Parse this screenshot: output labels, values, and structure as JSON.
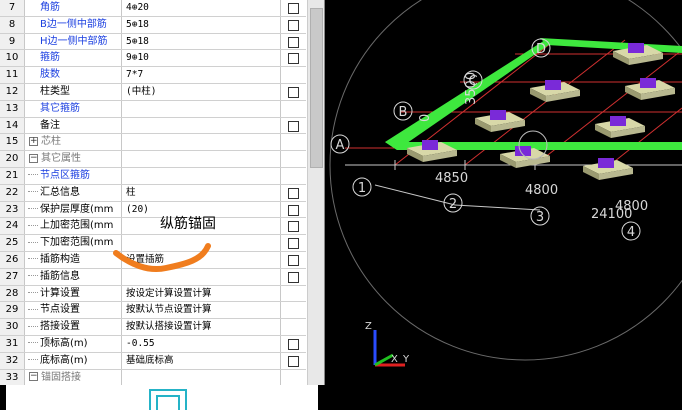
{
  "properties": {
    "rows": [
      {
        "num": "7",
        "name": "角筋",
        "value": "4⊕20",
        "blue": true,
        "checkbox": true
      },
      {
        "num": "8",
        "name": "B边一侧中部筋",
        "value": "5⊕18",
        "blue": true,
        "checkbox": true
      },
      {
        "num": "9",
        "name": "H边一侧中部筋",
        "value": "5⊕18",
        "blue": true,
        "checkbox": true
      },
      {
        "num": "10",
        "name": "箍筋",
        "value": "9⊕10",
        "blue": true,
        "checkbox": true
      },
      {
        "num": "11",
        "name": "肢数",
        "value": "7*7",
        "blue": true,
        "checkbox": false
      },
      {
        "num": "12",
        "name": "柱类型",
        "value": "(中柱)",
        "blue": false,
        "checkbox": true
      },
      {
        "num": "13",
        "name": "其它箍筋",
        "value": "",
        "blue": true,
        "checkbox": false
      },
      {
        "num": "14",
        "name": "备注",
        "value": "",
        "blue": false,
        "checkbox": true
      },
      {
        "num": "15",
        "name": "芯柱",
        "value": "",
        "group": true,
        "toggle": "+",
        "checkbox": false
      },
      {
        "num": "20",
        "name": "其它属性",
        "value": "",
        "group": true,
        "toggle": "−",
        "checkbox": false
      },
      {
        "num": "21",
        "name": "节点区箍筋",
        "value": "",
        "blue": true,
        "child": true,
        "checkbox": false
      },
      {
        "num": "22",
        "name": "汇总信息",
        "value": "柱",
        "blue": false,
        "child": true,
        "checkbox": true
      },
      {
        "num": "23",
        "name": "保护层厚度(mm",
        "value": "(20)",
        "blue": false,
        "child": true,
        "checkbox": true
      },
      {
        "num": "24",
        "name": "上加密范围(mm",
        "value": "",
        "blue": false,
        "child": true,
        "checkbox": true
      },
      {
        "num": "25",
        "name": "下加密范围(mm",
        "value": "",
        "blue": false,
        "child": true,
        "checkbox": true
      },
      {
        "num": "26",
        "name": "插筋构造",
        "value": "设置插筋",
        "blue": false,
        "child": true,
        "checkbox": true
      },
      {
        "num": "27",
        "name": "插筋信息",
        "value": "",
        "blue": false,
        "child": true,
        "checkbox": true
      },
      {
        "num": "28",
        "name": "计算设置",
        "value": "按设定计算设置计算",
        "blue": false,
        "child": true,
        "checkbox": false
      },
      {
        "num": "29",
        "name": "节点设置",
        "value": "按默认节点设置计算",
        "blue": false,
        "child": true,
        "checkbox": false
      },
      {
        "num": "30",
        "name": "搭接设置",
        "value": "按默认搭接设置计算",
        "blue": false,
        "child": true,
        "checkbox": false
      },
      {
        "num": "31",
        "name": "顶标高(m)",
        "value": "-0.55",
        "blue": false,
        "child": true,
        "checkbox": true
      },
      {
        "num": "32",
        "name": "底标高(m)",
        "value": "基础底标高",
        "blue": false,
        "child": true,
        "checkbox": true
      },
      {
        "num": "33",
        "name": "锚固搭接",
        "value": "",
        "group": true,
        "toggle": "−",
        "checkbox": false
      }
    ]
  },
  "annotation": {
    "text": "纵筋锚固",
    "stroke_color": "#f07d1e"
  },
  "viewport": {
    "axis_letters": [
      "A",
      "B",
      "C",
      "D"
    ],
    "axis_numbers": [
      "1",
      "2",
      "3",
      "4"
    ],
    "dimensions": [
      "4850",
      "4800",
      "24100",
      "4800",
      "3500"
    ],
    "dimension_text_left": "0",
    "triad": {
      "x": "X",
      "y": "Y",
      "z": "Z"
    },
    "colors": {
      "beam": "#3ee83e",
      "column": "#7a2ad8",
      "footing": "#b8b890",
      "gridline": "#d03030",
      "background": "#000000"
    }
  }
}
